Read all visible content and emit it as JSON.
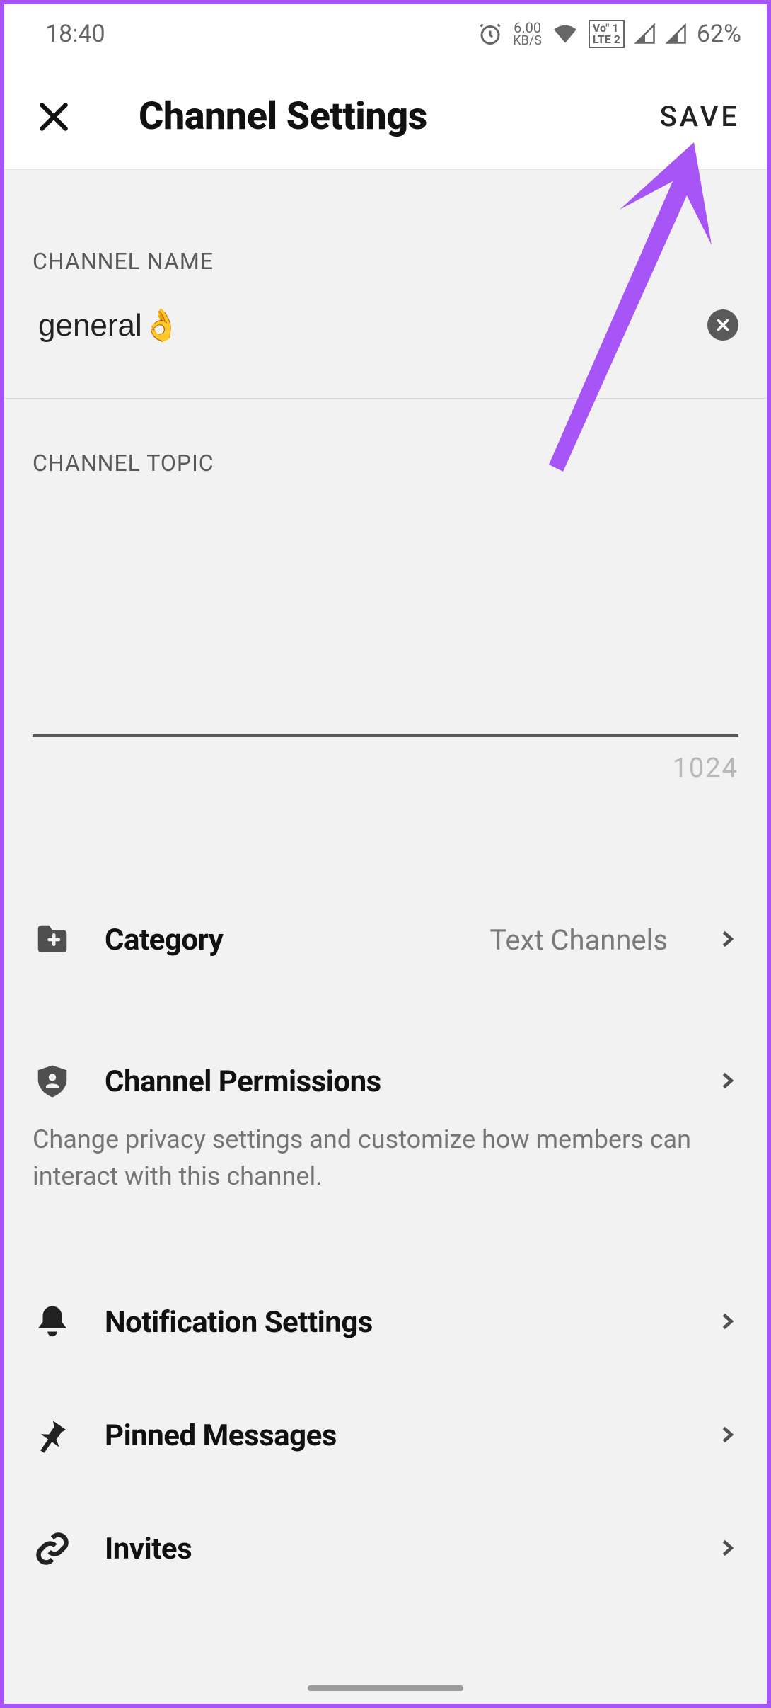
{
  "statusbar": {
    "time": "18:40",
    "net_speed_top": "6.00",
    "net_speed_bottom": "KB/S",
    "lte_top": "Vo\" 1",
    "lte_bottom": "LTE 2",
    "battery": "62%"
  },
  "header": {
    "title": "Channel Settings",
    "save_label": "SAVE"
  },
  "channel_name": {
    "section_label": "CHANNEL NAME",
    "value": "general👌"
  },
  "channel_topic": {
    "section_label": "CHANNEL TOPIC",
    "value": "",
    "max": "1024"
  },
  "rows": {
    "category": {
      "label": "Category",
      "value": "Text Channels"
    },
    "permissions": {
      "label": "Channel Permissions",
      "desc": "Change privacy settings and customize how members can interact with this channel."
    },
    "notifications": {
      "label": "Notification Settings"
    },
    "pinned": {
      "label": "Pinned Messages"
    },
    "invites": {
      "label": "Invites"
    }
  }
}
